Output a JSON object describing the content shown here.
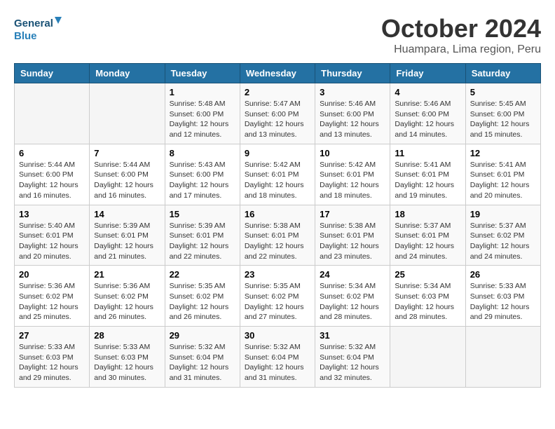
{
  "header": {
    "logo_text_general": "General",
    "logo_text_blue": "Blue",
    "month": "October 2024",
    "location": "Huampara, Lima region, Peru"
  },
  "days_of_week": [
    "Sunday",
    "Monday",
    "Tuesday",
    "Wednesday",
    "Thursday",
    "Friday",
    "Saturday"
  ],
  "weeks": [
    [
      {
        "day": "",
        "content": ""
      },
      {
        "day": "",
        "content": ""
      },
      {
        "day": "1",
        "content": "Sunrise: 5:48 AM\nSunset: 6:00 PM\nDaylight: 12 hours\nand 12 minutes."
      },
      {
        "day": "2",
        "content": "Sunrise: 5:47 AM\nSunset: 6:00 PM\nDaylight: 12 hours\nand 13 minutes."
      },
      {
        "day": "3",
        "content": "Sunrise: 5:46 AM\nSunset: 6:00 PM\nDaylight: 12 hours\nand 13 minutes."
      },
      {
        "day": "4",
        "content": "Sunrise: 5:46 AM\nSunset: 6:00 PM\nDaylight: 12 hours\nand 14 minutes."
      },
      {
        "day": "5",
        "content": "Sunrise: 5:45 AM\nSunset: 6:00 PM\nDaylight: 12 hours\nand 15 minutes."
      }
    ],
    [
      {
        "day": "6",
        "content": "Sunrise: 5:44 AM\nSunset: 6:00 PM\nDaylight: 12 hours\nand 16 minutes."
      },
      {
        "day": "7",
        "content": "Sunrise: 5:44 AM\nSunset: 6:00 PM\nDaylight: 12 hours\nand 16 minutes."
      },
      {
        "day": "8",
        "content": "Sunrise: 5:43 AM\nSunset: 6:00 PM\nDaylight: 12 hours\nand 17 minutes."
      },
      {
        "day": "9",
        "content": "Sunrise: 5:42 AM\nSunset: 6:01 PM\nDaylight: 12 hours\nand 18 minutes."
      },
      {
        "day": "10",
        "content": "Sunrise: 5:42 AM\nSunset: 6:01 PM\nDaylight: 12 hours\nand 18 minutes."
      },
      {
        "day": "11",
        "content": "Sunrise: 5:41 AM\nSunset: 6:01 PM\nDaylight: 12 hours\nand 19 minutes."
      },
      {
        "day": "12",
        "content": "Sunrise: 5:41 AM\nSunset: 6:01 PM\nDaylight: 12 hours\nand 20 minutes."
      }
    ],
    [
      {
        "day": "13",
        "content": "Sunrise: 5:40 AM\nSunset: 6:01 PM\nDaylight: 12 hours\nand 20 minutes."
      },
      {
        "day": "14",
        "content": "Sunrise: 5:39 AM\nSunset: 6:01 PM\nDaylight: 12 hours\nand 21 minutes."
      },
      {
        "day": "15",
        "content": "Sunrise: 5:39 AM\nSunset: 6:01 PM\nDaylight: 12 hours\nand 22 minutes."
      },
      {
        "day": "16",
        "content": "Sunrise: 5:38 AM\nSunset: 6:01 PM\nDaylight: 12 hours\nand 22 minutes."
      },
      {
        "day": "17",
        "content": "Sunrise: 5:38 AM\nSunset: 6:01 PM\nDaylight: 12 hours\nand 23 minutes."
      },
      {
        "day": "18",
        "content": "Sunrise: 5:37 AM\nSunset: 6:01 PM\nDaylight: 12 hours\nand 24 minutes."
      },
      {
        "day": "19",
        "content": "Sunrise: 5:37 AM\nSunset: 6:02 PM\nDaylight: 12 hours\nand 24 minutes."
      }
    ],
    [
      {
        "day": "20",
        "content": "Sunrise: 5:36 AM\nSunset: 6:02 PM\nDaylight: 12 hours\nand 25 minutes."
      },
      {
        "day": "21",
        "content": "Sunrise: 5:36 AM\nSunset: 6:02 PM\nDaylight: 12 hours\nand 26 minutes."
      },
      {
        "day": "22",
        "content": "Sunrise: 5:35 AM\nSunset: 6:02 PM\nDaylight: 12 hours\nand 26 minutes."
      },
      {
        "day": "23",
        "content": "Sunrise: 5:35 AM\nSunset: 6:02 PM\nDaylight: 12 hours\nand 27 minutes."
      },
      {
        "day": "24",
        "content": "Sunrise: 5:34 AM\nSunset: 6:02 PM\nDaylight: 12 hours\nand 28 minutes."
      },
      {
        "day": "25",
        "content": "Sunrise: 5:34 AM\nSunset: 6:03 PM\nDaylight: 12 hours\nand 28 minutes."
      },
      {
        "day": "26",
        "content": "Sunrise: 5:33 AM\nSunset: 6:03 PM\nDaylight: 12 hours\nand 29 minutes."
      }
    ],
    [
      {
        "day": "27",
        "content": "Sunrise: 5:33 AM\nSunset: 6:03 PM\nDaylight: 12 hours\nand 29 minutes."
      },
      {
        "day": "28",
        "content": "Sunrise: 5:33 AM\nSunset: 6:03 PM\nDaylight: 12 hours\nand 30 minutes."
      },
      {
        "day": "29",
        "content": "Sunrise: 5:32 AM\nSunset: 6:04 PM\nDaylight: 12 hours\nand 31 minutes."
      },
      {
        "day": "30",
        "content": "Sunrise: 5:32 AM\nSunset: 6:04 PM\nDaylight: 12 hours\nand 31 minutes."
      },
      {
        "day": "31",
        "content": "Sunrise: 5:32 AM\nSunset: 6:04 PM\nDaylight: 12 hours\nand 32 minutes."
      },
      {
        "day": "",
        "content": ""
      },
      {
        "day": "",
        "content": ""
      }
    ]
  ]
}
